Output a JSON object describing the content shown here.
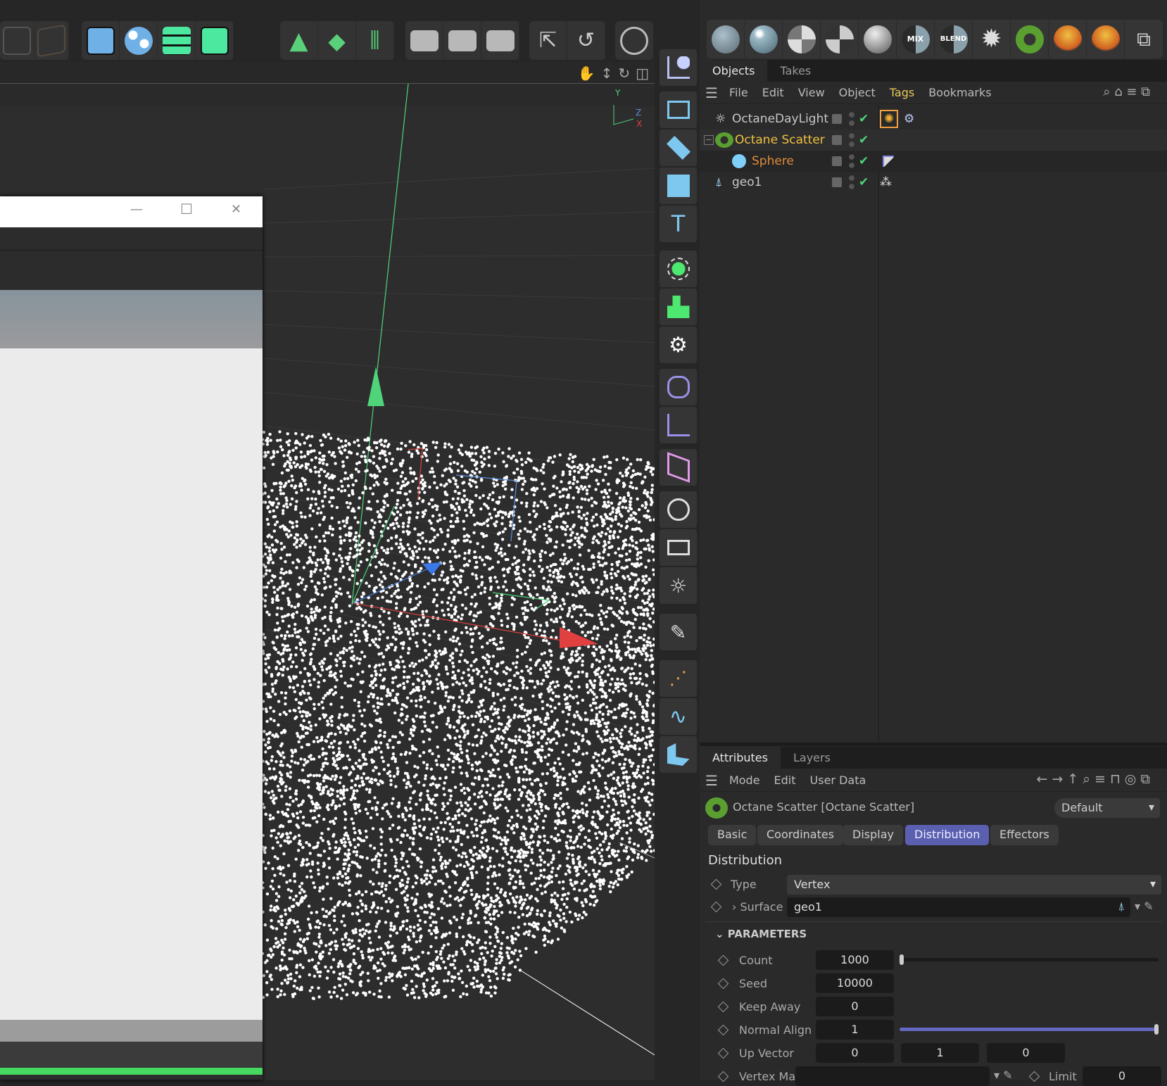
{
  "toolbar": {
    "groups": [
      {
        "name": "edit",
        "icons": [
          "mirror-icon",
          "box-icon"
        ]
      },
      {
        "name": "octane",
        "icons": [
          "octane-settings-icon",
          "scatter-icon",
          "list-icon",
          "spline-icon"
        ]
      },
      {
        "name": "generators",
        "icons": [
          "triangle-icon",
          "layers-icon",
          "symmetry-icon"
        ]
      },
      {
        "name": "render",
        "icons": [
          "clapper-icon",
          "render-play-icon",
          "render-settings-icon"
        ]
      },
      {
        "name": "coords",
        "icons": [
          "move-axis-icon",
          "rotate-axis-icon"
        ]
      },
      {
        "name": "misc",
        "icons": [
          "lens-icon"
        ]
      }
    ],
    "viewport_nav": [
      "pan-hand-icon",
      "dolly-icon",
      "rotate-icon",
      "maximize-icon"
    ]
  },
  "viewport": {
    "axis_labels": {
      "y": "Y",
      "z": "Z",
      "x": "X"
    }
  },
  "floating_window": {
    "controls": {
      "minimize": "—",
      "maximize": "☐",
      "close": "✕"
    },
    "progress_color": "#46d85f"
  },
  "materials": [
    "diffuse-material",
    "glossy-material",
    "checker-material",
    "specular-material",
    "metal-material",
    "MIX",
    "BLEND",
    "texture-gear",
    "scatter-object",
    "explosion-1",
    "explosion-2",
    "node-editor"
  ],
  "objects_panel": {
    "tabs": [
      "Objects",
      "Takes"
    ],
    "active_tab": "Objects",
    "menu": [
      "File",
      "Edit",
      "View",
      "Object",
      "Tags",
      "Bookmarks"
    ],
    "rows": [
      {
        "name": "OctaneDayLight",
        "color": "#c8c8c8",
        "icon": "daylight-icon"
      },
      {
        "name": "Octane Scatter",
        "color": "#f0c040",
        "icon": "scatter-icon"
      },
      {
        "name": "Sphere",
        "color": "#e08a3a",
        "icon": "sphere-icon"
      },
      {
        "name": "geo1",
        "color": "#c8c8c8",
        "icon": "geometry-icon"
      }
    ]
  },
  "attributes": {
    "tabs": [
      "Attributes",
      "Layers"
    ],
    "active_tab": "Attributes",
    "menu": [
      "Mode",
      "Edit",
      "User Data"
    ],
    "object_title": "Octane Scatter [Octane Scatter]",
    "preset": "Default",
    "subtabs": [
      "Basic",
      "Coordinates",
      "Display",
      "Distribution",
      "Effectors"
    ],
    "active_subtab": "Distribution",
    "section": "Distribution",
    "type": {
      "label": "Type",
      "value": "Vertex"
    },
    "surface": {
      "label": "Surface",
      "value": "geo1"
    },
    "group": "PARAMETERS",
    "params": {
      "count": {
        "label": "Count",
        "value": "1000",
        "slider": 0.0
      },
      "seed": {
        "label": "Seed",
        "value": "10000"
      },
      "keep_away": {
        "label": "Keep Away",
        "value": "0"
      },
      "normal_align": {
        "label": "Normal Align",
        "value": "1",
        "slider": 1.0
      },
      "up_vector": {
        "label": "Up Vector",
        "x": "0",
        "y": "1",
        "z": "0"
      },
      "vertex_map": {
        "label": "Vertex Map",
        "value": ""
      },
      "limit": {
        "label": "Limit",
        "value": "0"
      }
    }
  },
  "colors": {
    "accent": "#5a5fb0",
    "active_tag": "#f0a040"
  }
}
